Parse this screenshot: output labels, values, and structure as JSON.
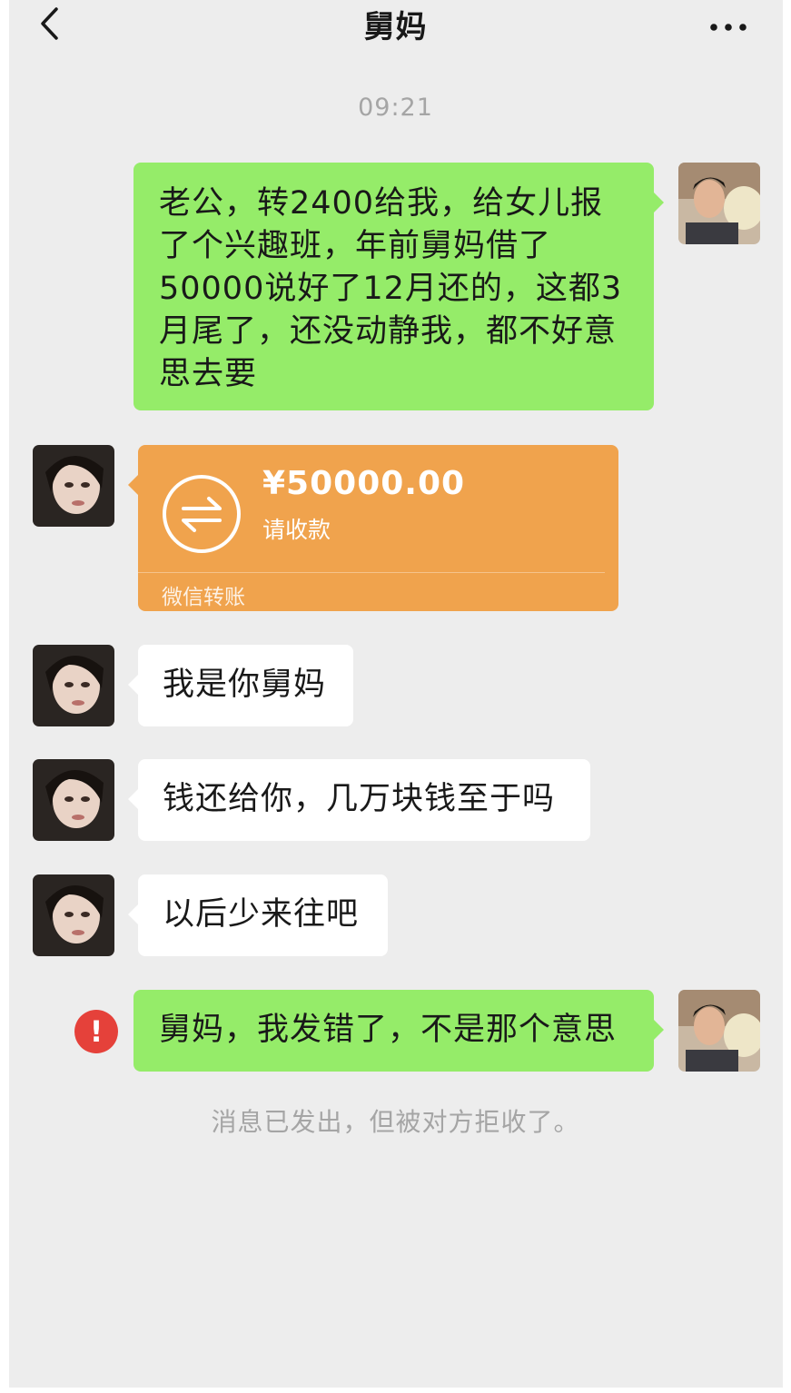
{
  "header": {
    "title": "舅妈",
    "back_icon": "chevron-left-icon",
    "more_icon": "more-dots-icon"
  },
  "chat": {
    "timestamp": "09:21",
    "messages": [
      {
        "from": "me",
        "lines": [
          "老公，转2400给我，给女儿报",
          "了个兴趣班，年前舅妈借了",
          "50000说好了12月还的，这都3",
          "月尾了，还没动静我，都不好意",
          "思去要"
        ]
      },
      {
        "from": "other",
        "type": "transfer",
        "amount": "¥50000.00",
        "status": "请收款",
        "label": "微信转账"
      },
      {
        "from": "other",
        "text": "我是你舅妈"
      },
      {
        "from": "other",
        "text": "钱还给你，几万块钱至于吗"
      },
      {
        "from": "other",
        "text": "以后少来往吧"
      },
      {
        "from": "me",
        "text": "舅妈，我发错了，不是那个意思",
        "error": "!"
      }
    ],
    "system_note": "消息已发出，但被对方拒收了。"
  },
  "colors": {
    "background": "#ededed",
    "my_bubble": "#95ec69",
    "their_bubble": "#ffffff",
    "transfer": "#f0a34d",
    "error": "#e5413a"
  }
}
